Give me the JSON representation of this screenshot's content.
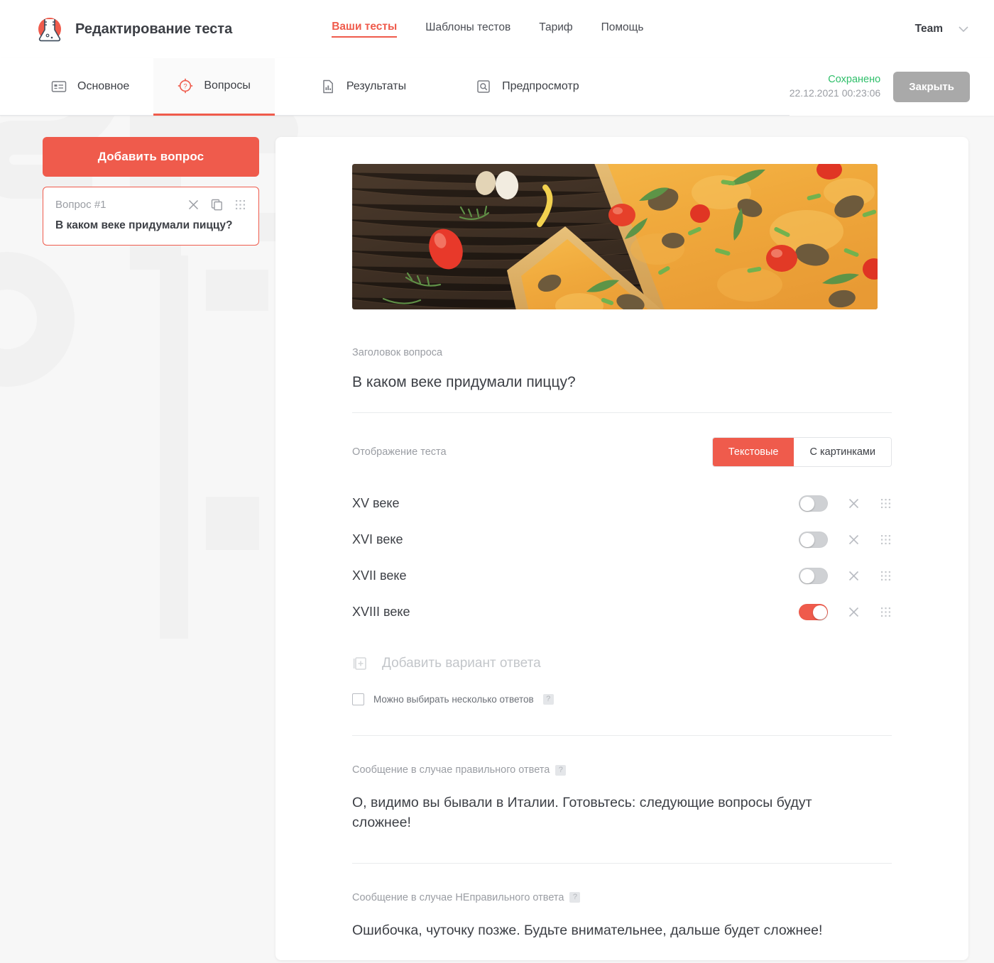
{
  "header": {
    "logo_icon": "flask-logo-icon",
    "title": "Редактирование теста",
    "nav": [
      {
        "label": "Ваши тесты",
        "active": true
      },
      {
        "label": "Шаблоны тестов",
        "active": false
      },
      {
        "label": "Тариф",
        "active": false
      },
      {
        "label": "Помощь",
        "active": false
      }
    ],
    "account_label": "Team",
    "chevron_icon": "chevron-down-icon"
  },
  "tabs": [
    {
      "label": "Основное",
      "icon": "list-card-icon",
      "active": false
    },
    {
      "label": "Вопросы",
      "icon": "target-question-icon",
      "active": true
    },
    {
      "label": "Результаты",
      "icon": "report-chart-icon",
      "active": false
    },
    {
      "label": "Предпросмотр",
      "icon": "magnifier-icon",
      "active": false
    }
  ],
  "save_status": {
    "state": "Сохранено",
    "timestamp": "22.12.2021 00:23:06",
    "close_label": "Закрыть",
    "state_color": "#2fbf6a"
  },
  "sidebar": {
    "add_question_label": "Добавить вопрос",
    "questions": [
      {
        "number_label": "Вопрос #1",
        "text": "В каком веке придумали пиццу?",
        "selected": true,
        "delete_icon": "close-icon",
        "copy_icon": "copy-icon",
        "drag_icon": "drag-handle-icon"
      }
    ]
  },
  "question": {
    "image_alt": "pizza-photo",
    "title_label": "Заголовок вопроса",
    "title_value": "В каком веке придумали пиццу?",
    "display_label": "Отображение теста",
    "display_modes": [
      {
        "label": "Текстовые",
        "active": true
      },
      {
        "label": "С картинками",
        "active": false
      }
    ],
    "options": [
      {
        "text": "XV веке",
        "correct": false
      },
      {
        "text": "XVI веке",
        "correct": false
      },
      {
        "text": "XVII веке",
        "correct": false
      },
      {
        "text": "XVIII веке",
        "correct": true
      }
    ],
    "add_option_label": "Добавить вариант ответа",
    "add_option_icon": "add-box-icon",
    "multi_answer_label": "Можно выбирать несколько ответов",
    "multi_answer_checked": false,
    "help_glyph": "?",
    "correct_msg_label": "Сообщение в случае правильного ответа",
    "correct_msg_value": "О, видимо вы бывали в Италии. Готовьтесь: следующие вопросы будут сложнее!",
    "incorrect_msg_label": "Сообщение в случае НЕправильного ответа",
    "incorrect_msg_value": "Ошибочка, чуточку позже. Будьте внимательнее, дальше будет сложнее!"
  },
  "colors": {
    "accent": "#ef5b4c",
    "text": "#3c3f45",
    "muted": "#9a9da3",
    "page_bg": "#f7f7f7",
    "success": "#2fbf6a"
  }
}
